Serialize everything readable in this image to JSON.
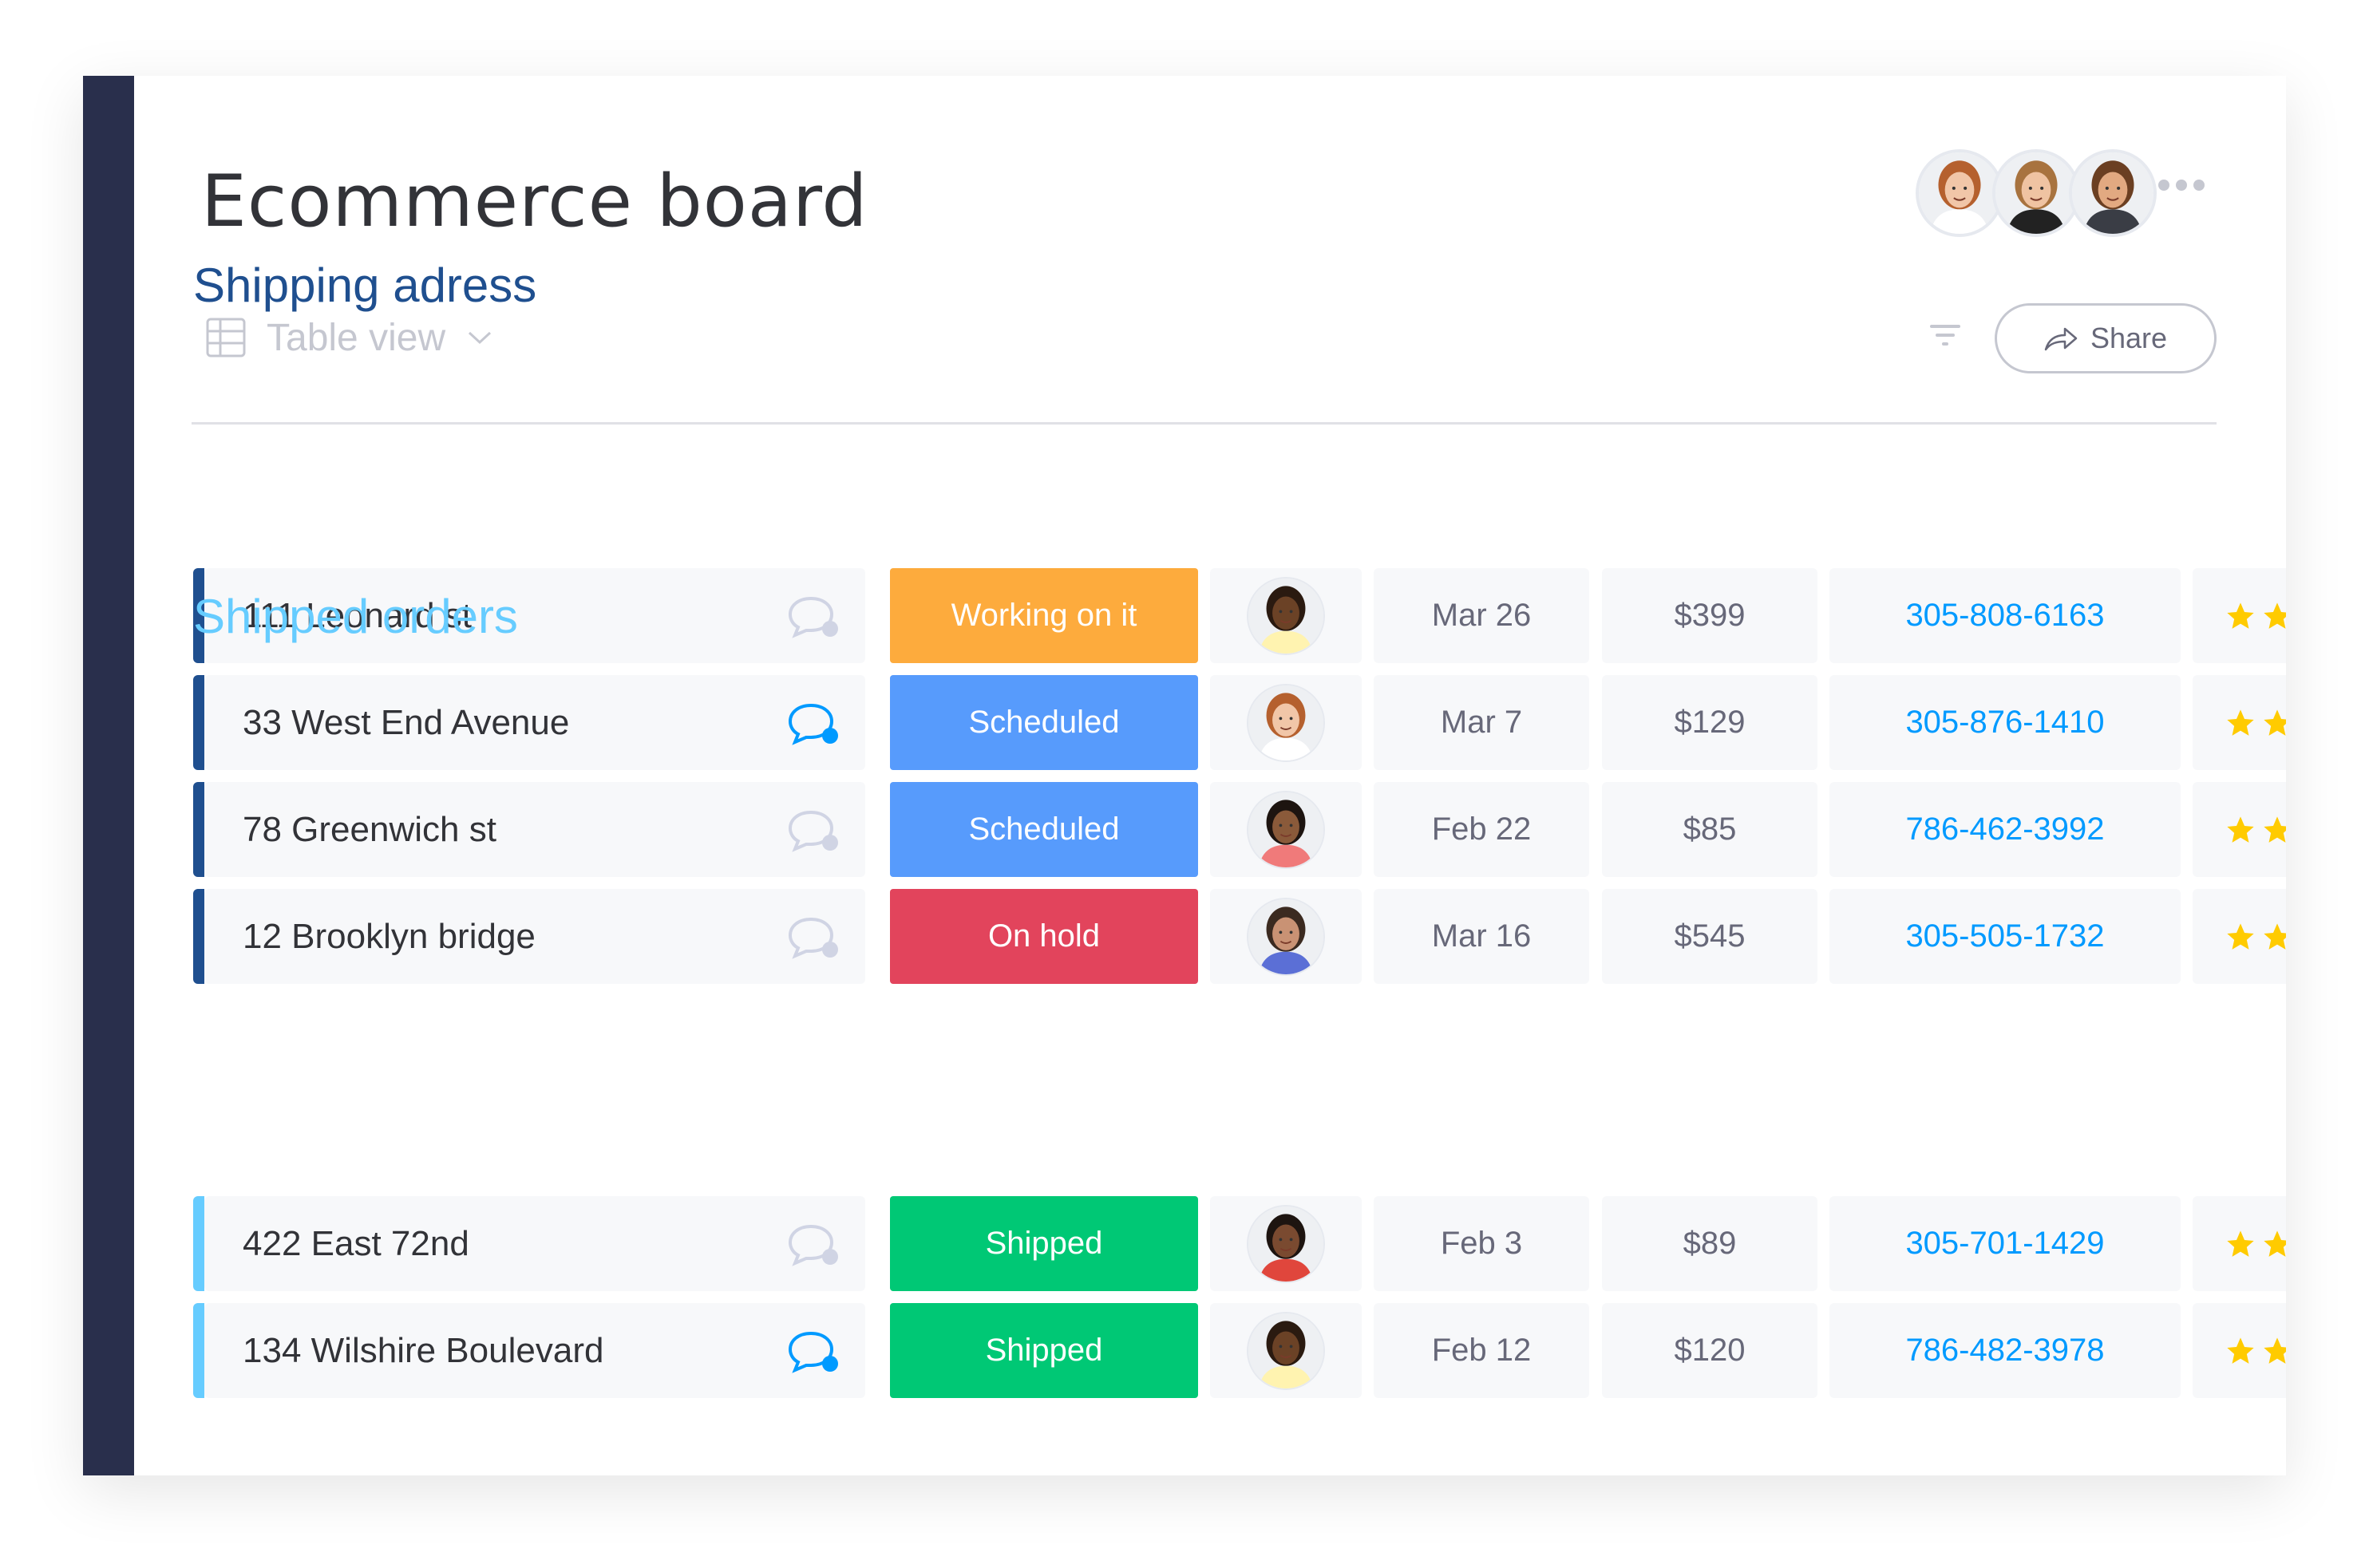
{
  "board": {
    "title": "Ecommerce board",
    "view_label": "Table view",
    "share_label": "Share",
    "members": [
      {
        "name": "member-1",
        "skin": "#f1c6a8",
        "hair": "#b5602e",
        "shirt": "#ffffff"
      },
      {
        "name": "member-2",
        "skin": "#efc3a2",
        "hair": "#a8733f",
        "shirt": "#222222"
      },
      {
        "name": "member-3",
        "skin": "#e2a981",
        "hair": "#6b3f22",
        "shirt": "#3a3d45"
      }
    ]
  },
  "colors": {
    "sidebar": "#292f4c",
    "group1": "#1f4f8f",
    "group2": "#66ccff",
    "working_on_it": "#fdab3d",
    "scheduled": "#579bfc",
    "on_hold": "#e2445c",
    "shipped": "#00c875",
    "phone": "#009aff",
    "star": "#ffcb00",
    "chat_active": "#009aff",
    "chat_inactive": "#d0d4e4"
  },
  "groups": [
    {
      "title": "Shipping adress",
      "color": "#1f4f8f",
      "rows": [
        {
          "name": "111 Leonard st",
          "chat_active": false,
          "status": "Working on it",
          "status_color": "#fdab3d",
          "person": {
            "skin": "#6b4226",
            "hair": "#2a1a10",
            "shirt": "#fff3b0"
          },
          "date": "Mar 26",
          "price": "$399",
          "phone": "305-808-6163"
        },
        {
          "name": "33 West End Avenue",
          "chat_active": true,
          "status": "Scheduled",
          "status_color": "#579bfc",
          "person": {
            "skin": "#f1c6a8",
            "hair": "#b5602e",
            "shirt": "#ffffff"
          },
          "date": "Mar 7",
          "price": "$129",
          "phone": "305-876-1410"
        },
        {
          "name": "78 Greenwich st",
          "chat_active": false,
          "status": "Scheduled",
          "status_color": "#579bfc",
          "person": {
            "skin": "#8a5a3a",
            "hair": "#1d1410",
            "shirt": "#f07a7a"
          },
          "date": "Feb 22",
          "price": "$85",
          "phone": "786-462-3992"
        },
        {
          "name": "12 Brooklyn bridge",
          "chat_active": false,
          "status": "On hold",
          "status_color": "#e2445c",
          "person": {
            "skin": "#c99274",
            "hair": "#3b2a20",
            "shirt": "#5b6fd6"
          },
          "date": "Mar 16",
          "price": "$545",
          "phone": "305-505-1732"
        }
      ]
    },
    {
      "title": "Shipped orders",
      "color": "#66ccff",
      "rows": [
        {
          "name": "422 East 72nd",
          "chat_active": false,
          "status": "Shipped",
          "status_color": "#00c875",
          "person": {
            "skin": "#7a4a30",
            "hair": "#1d1410",
            "shirt": "#e0463c"
          },
          "date": "Feb 3",
          "price": "$89",
          "phone": "305-701-1429"
        },
        {
          "name": "134 Wilshire Boulevard",
          "chat_active": true,
          "status": "Shipped",
          "status_color": "#00c875",
          "person": {
            "skin": "#6b4226",
            "hair": "#2a1a10",
            "shirt": "#fff3b0"
          },
          "date": "Feb 12",
          "price": "$120",
          "phone": "786-482-3978"
        }
      ]
    }
  ]
}
